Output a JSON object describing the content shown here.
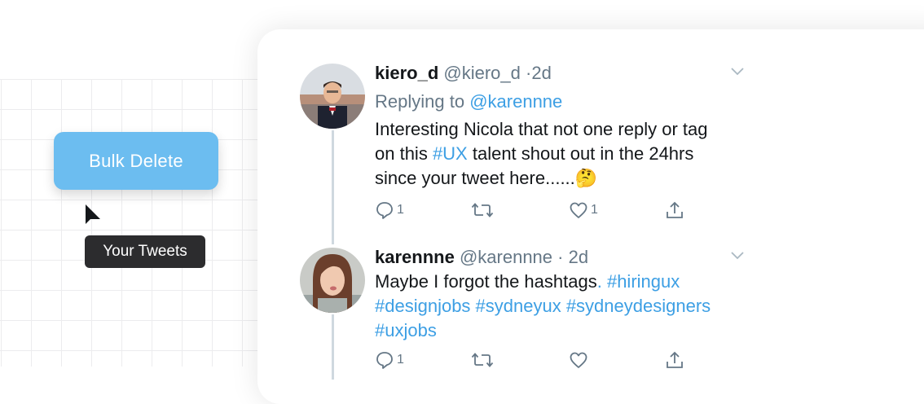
{
  "left_panel": {
    "bulk_delete_label": "Bulk Delete",
    "tooltip_label": "Your Tweets"
  },
  "colors": {
    "accent_button": "#6cbdf0",
    "link": "#3d9fe4",
    "muted_text": "#657786",
    "tooltip_bg": "#2c2c2e"
  },
  "tweets": [
    {
      "display_name": "kiero_d",
      "handle": "@kiero_d",
      "time": "·2d",
      "reply_prefix": "Replying to",
      "reply_to": "@karennne",
      "text_line1": "Interesting Nicola that not one reply or tag",
      "text_line2_pre": "on this ",
      "text_line2_tag": "#UX",
      "text_line2_post": " talent shout out in the 24hrs",
      "text_line3": "since your tweet here......🤔",
      "reply_count": "1",
      "like_count": "1"
    },
    {
      "display_name": "karennne",
      "handle": "@karennne",
      "time": "· 2d",
      "text_line1_pre": "Maybe I forgot the hashtags",
      "text_line1_tag": ". #hiringux",
      "text_line2": "#designjobs #sydneyux #sydneydesigners",
      "text_line3": "#uxjobs",
      "reply_count": "1",
      "like_count": ""
    }
  ],
  "icons": [
    "cursor-arrow-icon",
    "chevron-down-icon",
    "reply-icon",
    "retweet-icon",
    "like-icon",
    "share-icon"
  ]
}
